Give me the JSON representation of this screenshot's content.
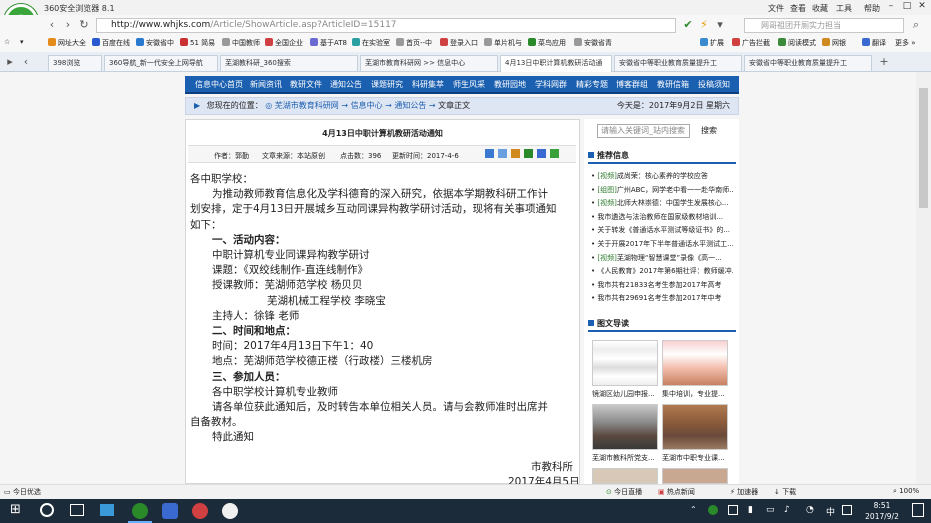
{
  "browser": {
    "app_title": "360安全浏览器 8.1",
    "title_menu": [
      "文件",
      "查看",
      "收藏",
      "工具",
      "帮助"
    ],
    "address": "http://www.whjks.com/Article/ShowArticle.asp?ArticleID=15117",
    "address_host": "http://www.whjks.com",
    "address_path": "/Article/ShowArticle.asp?ArticleID=15117",
    "search_placeholder": "网哥祖团开厕实力担当",
    "toolbar_right": [
      "扩展",
      "广告拦截",
      "阅读模式",
      "网银",
      "翻译",
      "更多"
    ],
    "bookmarks": [
      "网址大全",
      "百度在线",
      "安徽省中",
      "51 简易",
      "中国教师",
      "全国企业",
      "基于AT8",
      "在实验室",
      "首页--中",
      "登录入口",
      "单片机与",
      "菜鸟应用",
      "安徽省青"
    ],
    "tabs": [
      "398浏览",
      "360导航_新一代安全上网导航",
      "芜湖教科研_360搜索",
      "芜湖市教育科研网 >> 信息中心",
      "4月13日中职计算机教研活动通",
      "安徽省中等职业教育质量提升工",
      "安徽省中等职业教育质量提升工"
    ],
    "active_tab": 4
  },
  "site": {
    "nav": [
      "信息中心首页",
      "新闻资讯",
      "教研文件",
      "通知公告",
      "课题研究",
      "科研集萃",
      "师生风采",
      "教研园地",
      "学科网群",
      "精彩专题",
      "博客群组",
      "教研信箱",
      "投稿须知"
    ],
    "breadcrumb_label": "您现在的位置：",
    "breadcrumb": [
      "芜湖市教育科研网",
      "信息中心",
      "通知公告",
      "文章正文"
    ],
    "today": "今天是：2017年9月2日 星期六",
    "search_placeholder": "请输入关键词_站内搜索",
    "search_button": "搜索"
  },
  "article": {
    "title": "4月13日中职计算机教研活动通知",
    "author": "作者：郭勤",
    "source": "文章来源：本站原创",
    "hits": "点击数：396",
    "updated": "更新时间：2017-4-6",
    "lines": [
      {
        "t": "各中职学校：",
        "b": false,
        "i": 0
      },
      {
        "t": "为推动教师教育信息化及学科德育的深入研究，依据本学期教科研工作计",
        "b": false,
        "i": 2
      },
      {
        "t": "划安排，定于4月13日开展城乡互动同课异构教学研讨活动，现将有关事项通知",
        "b": false,
        "i": 0
      },
      {
        "t": "如下：",
        "b": false,
        "i": 0
      },
      {
        "t": "一、活动内容：",
        "b": true,
        "i": 2
      },
      {
        "t": "中职计算机专业同课异构教学研讨",
        "b": false,
        "i": 2
      },
      {
        "t": "课题：《双绞线制作-直连线制作》",
        "b": false,
        "i": 2
      },
      {
        "t": "授课教师：芜湖师范学校 杨贝贝",
        "b": false,
        "i": 2
      },
      {
        "t": "芜湖机械工程学校 李晓宝",
        "b": false,
        "i": 7
      },
      {
        "t": "主持人：徐锋 老师",
        "b": false,
        "i": 2
      },
      {
        "t": "二、时间和地点：",
        "b": true,
        "i": 2
      },
      {
        "t": "时间：2017年4月13日下午1：40",
        "b": false,
        "i": 2
      },
      {
        "t": "地点：芜湖师范学校德正楼（行政楼）三楼机房",
        "b": false,
        "i": 2
      },
      {
        "t": "三、参加人员：",
        "b": true,
        "i": 2
      },
      {
        "t": "各中职学校计算机专业教师",
        "b": false,
        "i": 2
      },
      {
        "t": "请各单位获此通知后，及时转告本单位相关人员。请与会教师准时出席并",
        "b": false,
        "i": 2
      },
      {
        "t": "自备教材。",
        "b": false,
        "i": 0
      },
      {
        "t": "特此通知",
        "b": false,
        "i": 2
      }
    ],
    "sign_org": "市教科所",
    "sign_date": "2017年4月5日"
  },
  "recommend": {
    "header": "推荐信息",
    "items": [
      {
        "tag": "[视频]",
        "text": "成尚荣：核心素养的学校应答"
      },
      {
        "tag": "[组图]",
        "text": "广州ABC，网学老中看一一赴华南师..."
      },
      {
        "tag": "[视频]",
        "text": "北师大林崇德：中国学生发展核心..."
      },
      {
        "tag": "",
        "text": "我市遴选与法治教师在国家级教材培训..."
      },
      {
        "tag": "",
        "text": "关于转发《普通话水平测试等级证书》的..."
      },
      {
        "tag": "",
        "text": "关于开展2017年下半年普通话水平测试工..."
      },
      {
        "tag": "[视频]",
        "text": "芜湖物理“智慧课堂”录像《高一..."
      },
      {
        "tag": "",
        "text": "《人民教育》2017年第6期社评：教师缓冲..."
      },
      {
        "tag": "",
        "text": "我市共有21833名考生参加2017年高考"
      },
      {
        "tag": "",
        "text": "我市共有29691名考生参加2017年中考"
      }
    ]
  },
  "gallery": {
    "header": "图文导读",
    "items": [
      {
        "caption": "镜湖区幼儿园申报..."
      },
      {
        "caption": "集中培训，专业提..."
      },
      {
        "caption": "芜湖市教科所党支..."
      },
      {
        "caption": "芜湖市中职专业课..."
      }
    ]
  },
  "statusbar": {
    "left": "今日优选",
    "items": [
      "今日直播",
      "热点新闻",
      "加速器",
      "下载"
    ],
    "zoom": "100%"
  },
  "taskbar": {
    "time": "8:51",
    "date": "2017/9/2",
    "lang": "中"
  }
}
